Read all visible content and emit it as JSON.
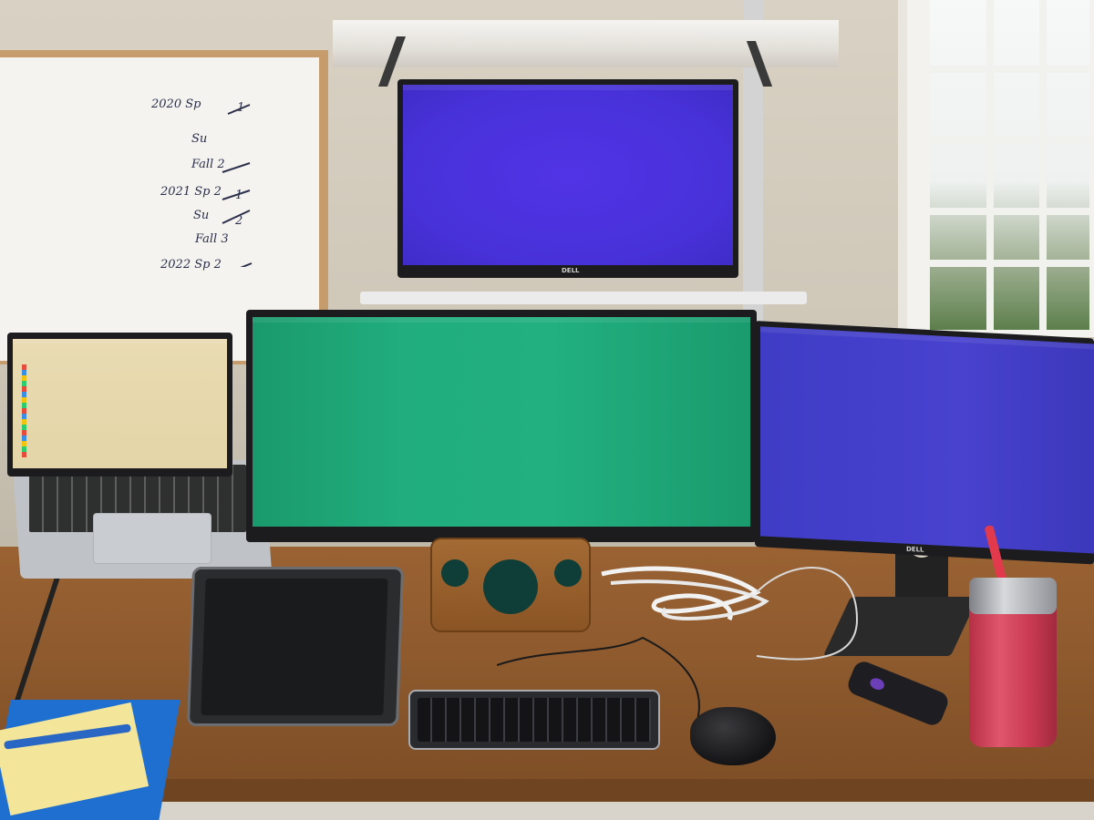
{
  "scene": {
    "description_colors": {
      "wall": "#d2cabc",
      "desk": "#8f5a2e",
      "top_screen": "#4b32dc",
      "center_screen": "#20ab7c",
      "right_screen": "#433fc9",
      "laptop_screen": "#e6d8ac",
      "tumbler": "#d24a60",
      "folder": "#1f6fd0"
    }
  },
  "whiteboard": {
    "lines": [
      "2020  Sp",
      "Su",
      "Fall  2",
      "2021  Sp  2",
      "Su",
      "Fall  3",
      "2022  Sp  2"
    ],
    "tally_right": [
      "1",
      "1",
      "2"
    ]
  },
  "brands": {
    "top_monitor": "DELL",
    "right_monitor": "DELL"
  },
  "icons": {
    "speaker": "speaker-icon",
    "mouse": "mouse-icon",
    "remote": "remote-icon"
  }
}
